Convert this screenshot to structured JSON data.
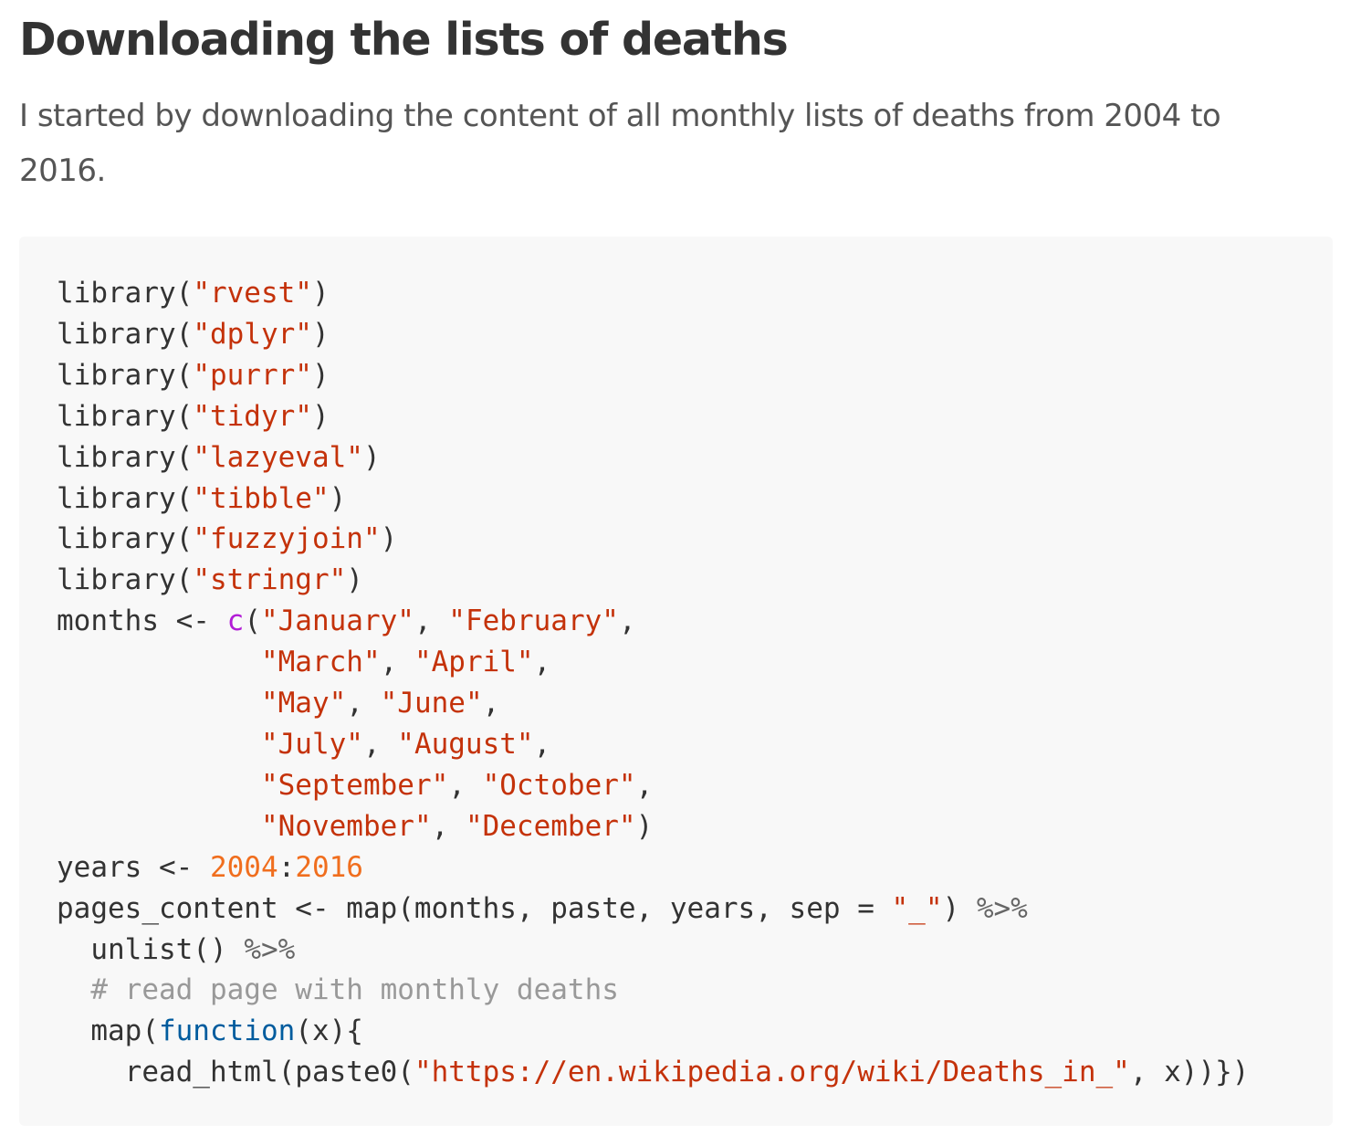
{
  "article": {
    "heading": "Downloading the lists of deaths",
    "intro": "I started by downloading the content of all monthly lists of deaths from 2004 to 2016."
  },
  "code": {
    "lib1": "library(",
    "pkg1": "\"rvest\"",
    "close1": ")",
    "lib2": "library(",
    "pkg2": "\"dplyr\"",
    "close2": ")",
    "lib3": "library(",
    "pkg3": "\"purrr\"",
    "close3": ")",
    "lib4": "library(",
    "pkg4": "\"tidyr\"",
    "close4": ")",
    "lib5": "library(",
    "pkg5": "\"lazyeval\"",
    "close5": ")",
    "lib6": "library(",
    "pkg6": "\"tibble\"",
    "close6": ")",
    "lib7": "library(",
    "pkg7": "\"fuzzyjoin\"",
    "close7": ")",
    "lib8": "library(",
    "pkg8": "\"stringr\"",
    "close8": ")",
    "months_assign": "months <- ",
    "c_fn": "c",
    "open_paren": "(",
    "m_jan": "\"January\"",
    "m_feb": "\"February\"",
    "m_mar": "\"March\"",
    "m_apr": "\"April\"",
    "m_may": "\"May\"",
    "m_jun": "\"June\"",
    "m_jul": "\"July\"",
    "m_aug": "\"August\"",
    "m_sep": "\"September\"",
    "m_oct": "\"October\"",
    "m_nov": "\"November\"",
    "m_dec": "\"December\"",
    "comma": ",",
    "comma_sp": ", ",
    "close_paren": ")",
    "indent_months": "            ",
    "years_assign": "years <- ",
    "year_start": "2004",
    "colon": ":",
    "year_end": "2016",
    "pages_line": "pages_content <- map(months, paste, years, sep = ",
    "sep_str": "\"_\"",
    "pipe_tail1": ") ",
    "pipe": "%>%",
    "unlist_line": "  unlist() ",
    "comment_line": "  # read page with monthly deaths",
    "map_start": "  map(",
    "function_kw": "function",
    "map_end": "(x){",
    "read_start": "    read_html(paste0(",
    "url_str": "\"https://en.wikipedia.org/wiki/Deaths_in_\"",
    "read_end": ", x))})"
  }
}
